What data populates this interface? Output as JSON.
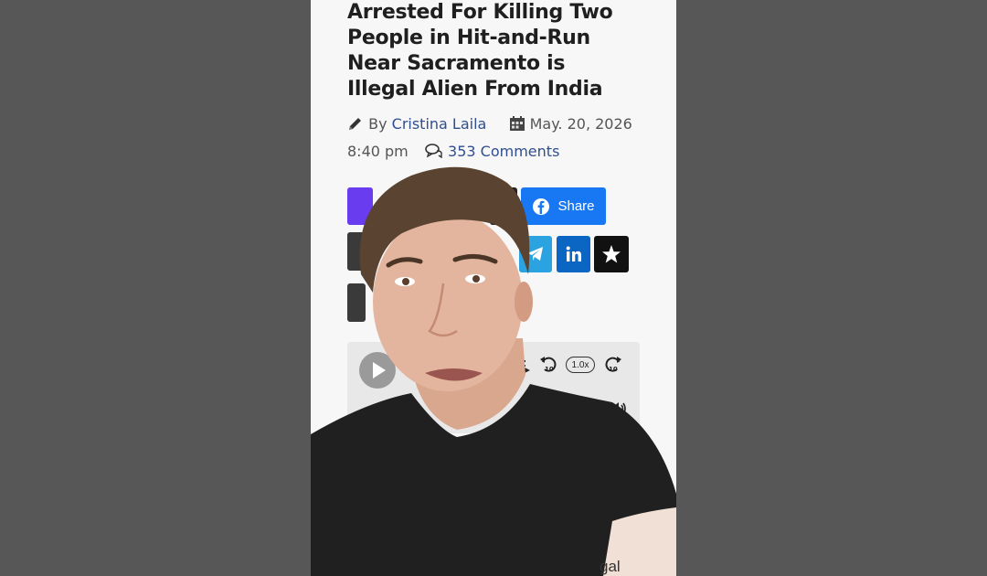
{
  "article": {
    "headline_lines": [
      "Arrested For Killing Two",
      "People in Hit-and-Run",
      "Near Sacramento is",
      "Illegal Alien From India"
    ],
    "by_label": "By",
    "author": "Cristina Laila",
    "date": "May. 20, 2026",
    "time": "8:40 pm",
    "comments": "353 Comments",
    "trailing_text": "gal"
  },
  "share": {
    "facebook_label": "Share"
  },
  "audio_player": {
    "speed": "1.0x"
  },
  "colors": {
    "page_background": "#575757",
    "article_background": "#f7f7f7",
    "facebook": "#1877f2",
    "telegram": "#2aa3e0",
    "linkedin": "#0a66c2",
    "purple_button": "#6a3cf0",
    "link": "#2f4f8f"
  },
  "icons": [
    "pencil-icon",
    "calendar-icon",
    "comments-icon",
    "facebook-icon",
    "telegram-icon",
    "linkedin-icon",
    "star-icon",
    "play-icon",
    "playlist-icon",
    "rewind-10-icon",
    "forward-10-icon",
    "volume-icon"
  ]
}
